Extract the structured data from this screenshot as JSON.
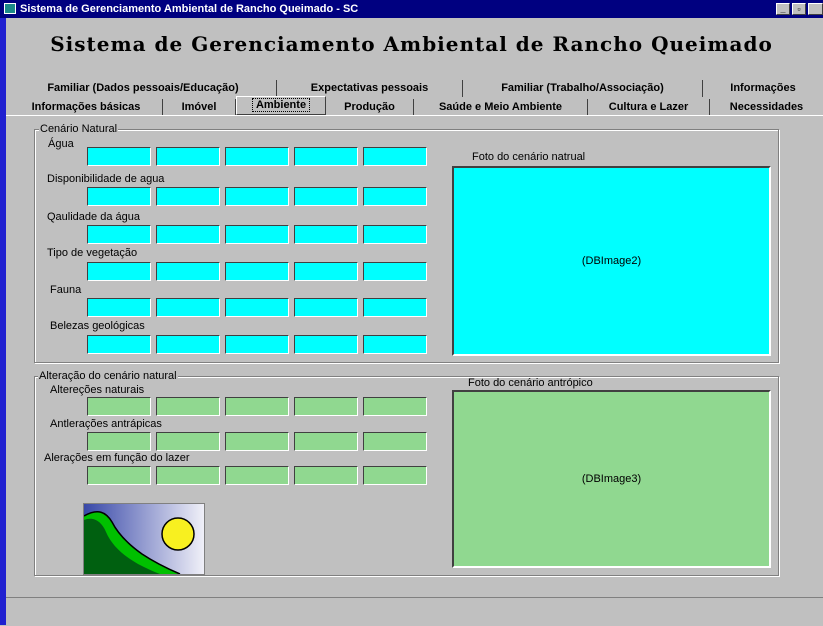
{
  "window": {
    "title": "Sistema de Gerenciamento Ambiental de Rancho Queimado - SC",
    "minimize": "_",
    "maximize": "▫",
    "close": ""
  },
  "heading": "Sistema de Gerenciamento Ambiental de Rancho Queimado",
  "tabs": {
    "row1": [
      "Familiar (Dados pessoais/Educação)",
      "Expectativas pessoais",
      "Familiar (Trabalho/Associação)",
      "Informações"
    ],
    "row2": [
      "Informações básicas",
      "Imóvel",
      "Ambiente",
      "Produção",
      "Saúde e Meio Ambiente",
      "Cultura e Lazer",
      "Necessidades"
    ],
    "active": "Ambiente"
  },
  "natural": {
    "title": "Cenário Natural",
    "labels": [
      "Água",
      "Disponibilidade de agua",
      "Qaulidade da água",
      "Tipo de vegetação",
      "Fauna",
      "Belezas geológicas"
    ],
    "photo_label": "Foto do cenário natrual",
    "photo_placeholder": "(DBImage2)"
  },
  "altered": {
    "title": "Alteração do cenário natural",
    "labels": [
      "Altereções naturais",
      "Antlerações antrápicas",
      "Alerações em função do lazer"
    ],
    "photo_label": "Foto do cenário antrópico",
    "photo_placeholder": "(DBImage3)"
  },
  "icons": {
    "logo": "landscape-sun-logo-icon"
  },
  "colors": {
    "titlebar": "#000080",
    "natural_fields": "#00ffff",
    "altered_fields": "#90d890"
  }
}
